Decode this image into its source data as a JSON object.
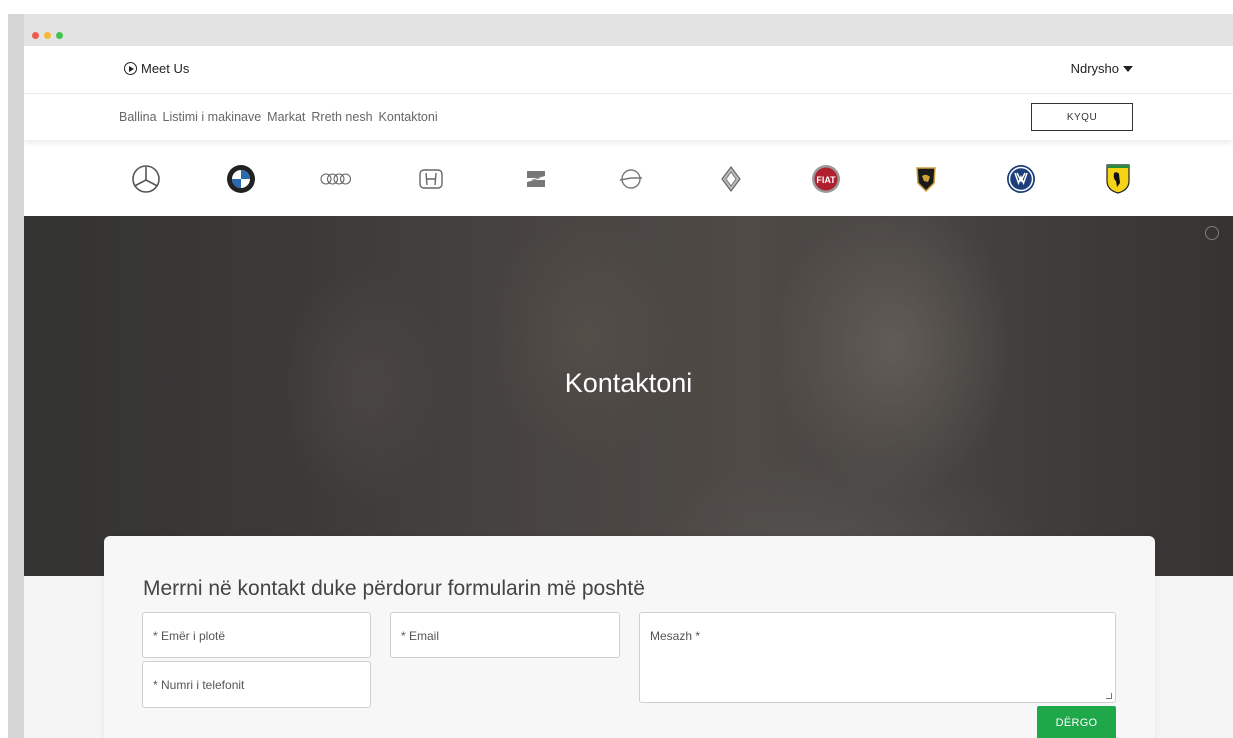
{
  "window": {
    "dots": [
      {
        "name": "close-dot",
        "color": "#ee5b50"
      },
      {
        "name": "minimize-dot",
        "color": "#f5b73b"
      },
      {
        "name": "maximize-dot",
        "color": "#3fc44f"
      }
    ]
  },
  "topbar": {
    "meet_us_label": "Meet Us",
    "meet_us_icon": "play-circle-icon",
    "language_label": "Ndrysho"
  },
  "nav": {
    "links": [
      "Ballina",
      "Listimi i makinave",
      "Markat",
      "Rreth nesh",
      "Kontaktoni"
    ],
    "login_label": "KYQU"
  },
  "brands": [
    "Mercedes-Benz",
    "BMW",
    "Audi",
    "Honda",
    "SEAT",
    "Opel",
    "Renault",
    "Fiat",
    "Lamborghini",
    "Volkswagen",
    "Ferrari"
  ],
  "hero": {
    "title": "Kontaktoni"
  },
  "contact_form": {
    "heading": "Merrni në kontakt duke përdorur formularin më poshtë",
    "full_name_placeholder": "* Emër i plotë",
    "email_placeholder": "* Email",
    "phone_placeholder": "* Numri i telefonit",
    "message_placeholder": "Mesazh *",
    "submit_label": "DËRGO"
  },
  "colors": {
    "accent_green": "#1fa84a",
    "fiat_red": "#b01f2e",
    "ferrari_yellow": "#f5d418",
    "vw_blue": "#1d3e7a"
  }
}
